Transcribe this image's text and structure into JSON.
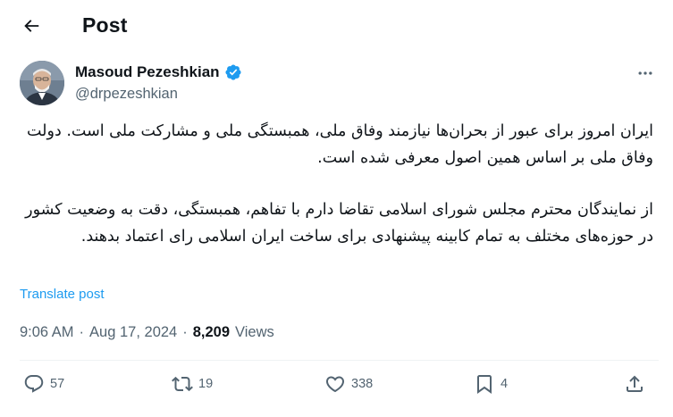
{
  "header": {
    "title": "Post"
  },
  "author": {
    "name": "Masoud Pezeshkian",
    "handle": "@drpezeshkian",
    "verified": true
  },
  "tweet": {
    "paragraphs": [
      "ایران امروز برای عبور از بحران‌ها نیازمند وفاق ملی، همبستگی ملی و مشارکت ملی است. دولت وفاق ملی بر اساس همین اصول معرفی شده است.",
      "از نمایندگان محترم مجلس شورای اسلامی تقاضا دارم با تفاهم، همبستگی، دقت به وضعیت کشور در حوزه‌های مختلف به تمام کابینه پیشنهادی برای ساخت ایران اسلامی رای اعتماد بدهند."
    ],
    "translate_label": "Translate post"
  },
  "meta": {
    "time": "9:06 AM",
    "date": "Aug 17, 2024",
    "separator": "·",
    "views_count": "8,209",
    "views_label": "Views"
  },
  "actions": {
    "replies": "57",
    "reposts": "19",
    "likes": "338",
    "bookmarks": "4"
  },
  "colors": {
    "accent": "#1d9bf0",
    "text": "#0f1419",
    "secondary": "#536471"
  },
  "icons": [
    "back-arrow-icon",
    "verified-badge-icon",
    "more-icon",
    "reply-icon",
    "repost-icon",
    "like-icon",
    "bookmark-icon",
    "share-icon"
  ]
}
